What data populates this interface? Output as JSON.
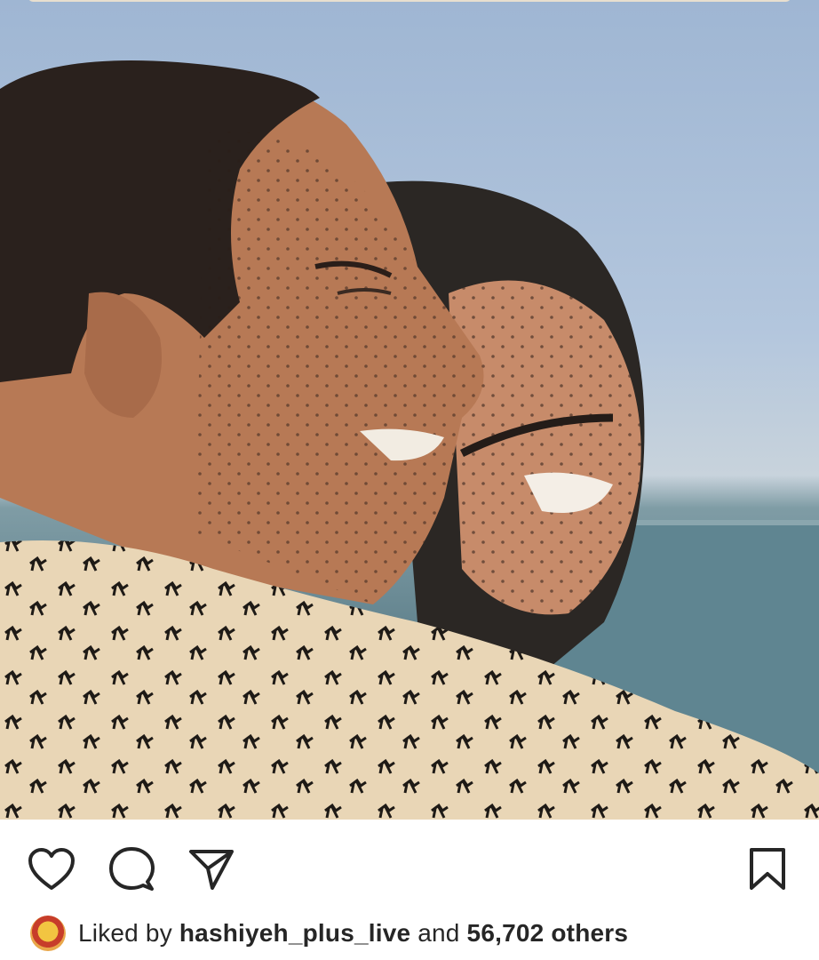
{
  "post": {
    "image_alt": "",
    "actions": {
      "like_icon": "heart-icon",
      "comment_icon": "comment-bubble-icon",
      "share_icon": "paper-plane-icon",
      "save_icon": "bookmark-icon"
    },
    "likes": {
      "prefix": "Liked by ",
      "user": "hashiyeh_plus_live",
      "middle": " and ",
      "count": "56,702 others"
    }
  },
  "colors": {
    "text": "#262626",
    "icon": "#262626"
  }
}
